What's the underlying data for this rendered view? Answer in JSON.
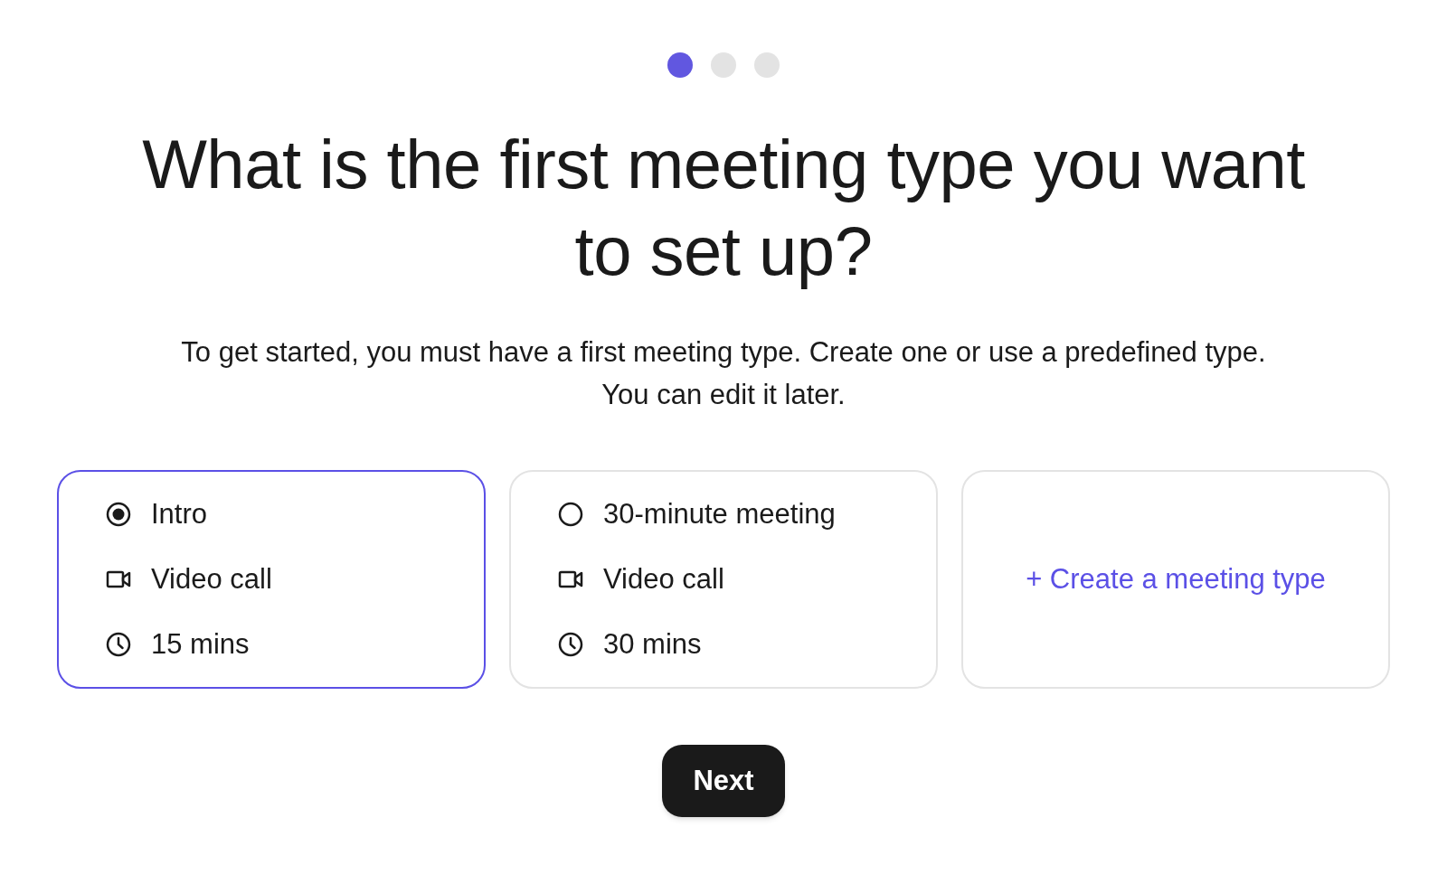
{
  "steps": [
    {
      "selected": true
    },
    {
      "selected": false
    },
    {
      "selected": false
    }
  ],
  "title": "What is the first meeting type you want to set up?",
  "intro": [
    "To get started, you must have a first meeting type. Create one or use a predefined type.",
    "You can edit it later."
  ],
  "options": [
    {
      "kind": "meeting",
      "selected": true,
      "name": "Intro",
      "location": "Video call",
      "duration": "15 mins"
    },
    {
      "kind": "meeting",
      "selected": false,
      "name": "30-minute meeting",
      "location": "Video call",
      "duration": "30 mins"
    },
    {
      "kind": "create",
      "label": "+ Create a meeting type"
    }
  ],
  "next_button": "Next"
}
